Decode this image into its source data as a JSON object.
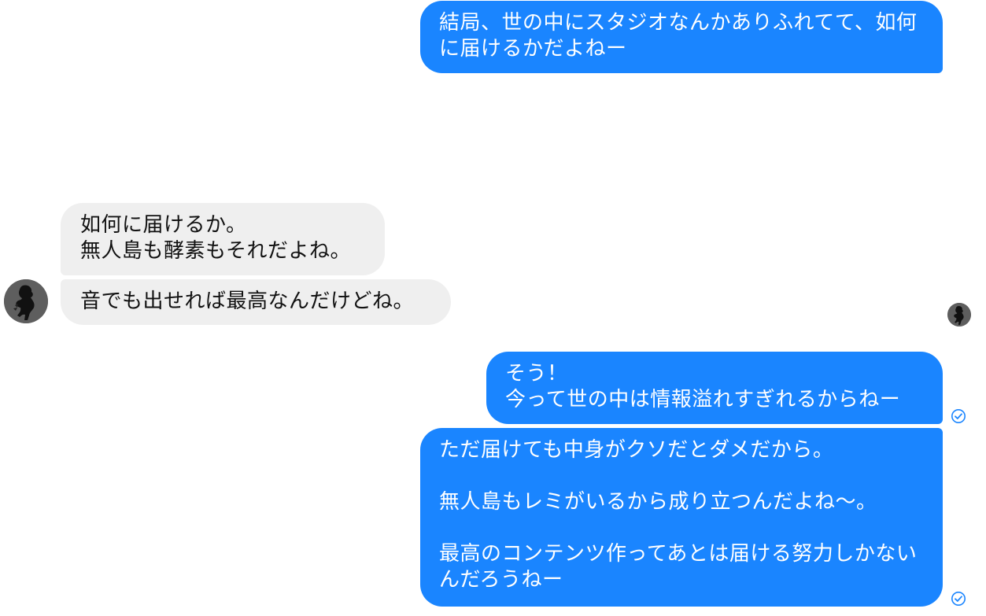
{
  "conversation": {
    "messages": [
      {
        "direction": "outgoing",
        "text": "結局、世の中にスタジオなんかありふれてて、如何に届けるかだよねー"
      },
      {
        "direction": "incoming",
        "text": "如何に届けるか。\n無人島も酵素もそれだよね。"
      },
      {
        "direction": "incoming",
        "text": "音でも出せれば最高なんだけどね。"
      },
      {
        "direction": "outgoing",
        "text": "そう！\n今って世の中は情報溢れすぎれるからねー"
      },
      {
        "direction": "outgoing",
        "text": "ただ届けても中身がクソだとダメだから。\n\n無人島もレミがいるから成り立つんだよね〜。\n\n最高のコンテンツ作ってあとは届ける努力しかないんだろうねー"
      }
    ]
  },
  "colors": {
    "outgoing_bubble": "#1a85ff",
    "incoming_bubble": "#efefef",
    "outgoing_text": "#ffffff",
    "incoming_text": "#111111",
    "status_icon": "#1a85ff"
  },
  "icons": {
    "contact_avatar": "silhouette-avatar-icon",
    "read_receipt": "read-receipt-avatar-icon",
    "delivered": "delivered-check-icon"
  }
}
